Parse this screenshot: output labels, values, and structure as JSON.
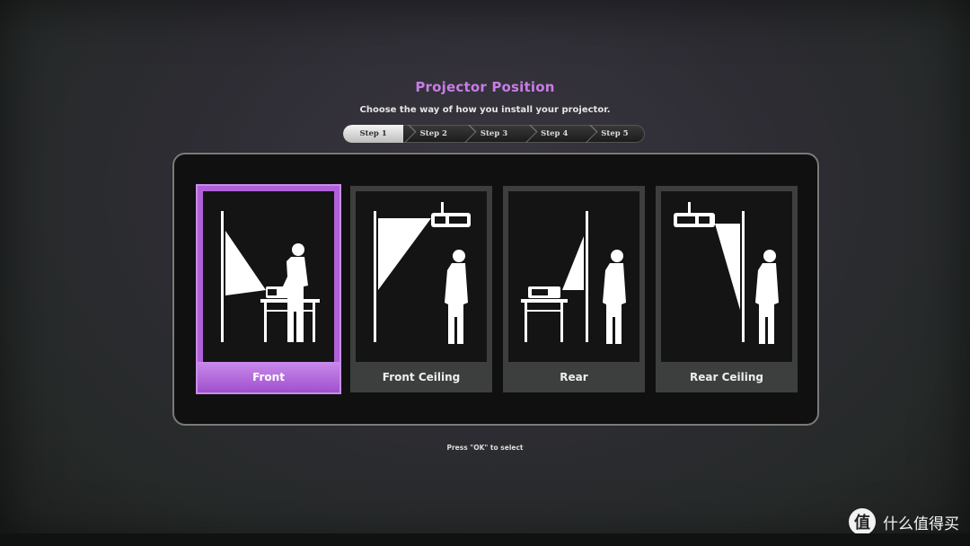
{
  "header": {
    "title": "Projector Position",
    "subtitle": "Choose the way of how you install your projector."
  },
  "steps": {
    "items": [
      "Step 1",
      "Step 2",
      "Step 3",
      "Step 4",
      "Step 5"
    ],
    "active_index": 0
  },
  "options": {
    "items": [
      {
        "label": "Front",
        "selected": true
      },
      {
        "label": "Front Ceiling",
        "selected": false
      },
      {
        "label": "Rear",
        "selected": false
      },
      {
        "label": "Rear Ceiling",
        "selected": false
      }
    ]
  },
  "footer": {
    "hint": "Press \"OK\" to select"
  },
  "watermark": {
    "logo_text": "值",
    "text": "什么值得买"
  },
  "colors": {
    "accent": "#c77de6",
    "selected_card": "#b060d8"
  }
}
